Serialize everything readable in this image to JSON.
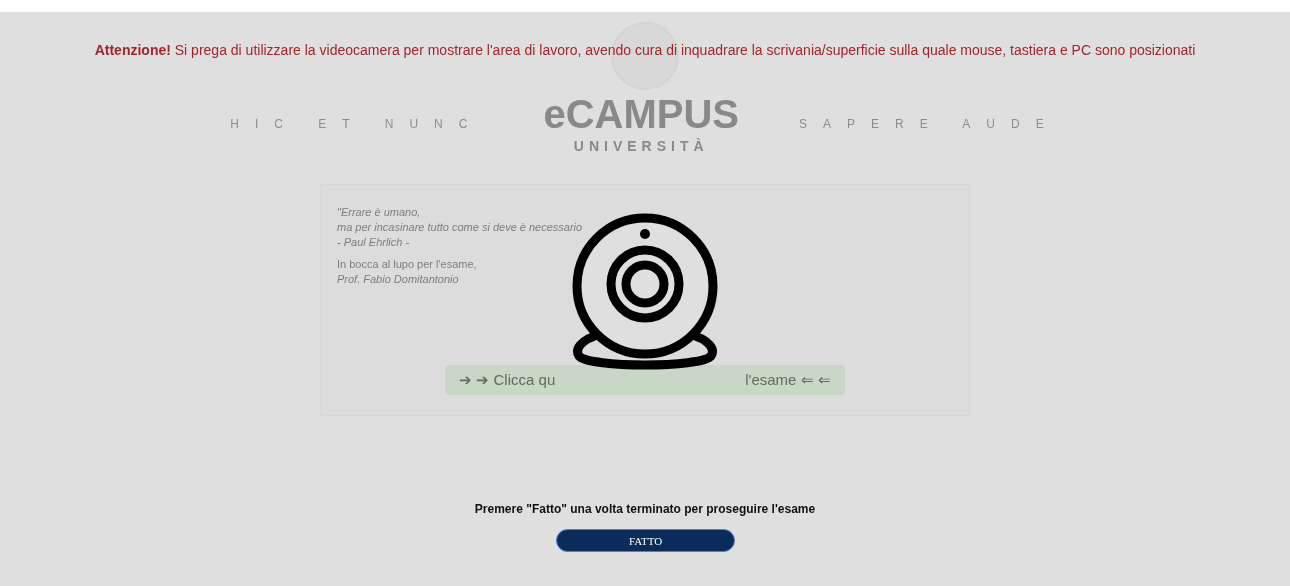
{
  "background_page": {
    "motto_left": "HIC ET NUNC",
    "logo_text": "eCAMPUS",
    "logo_subtext": "UNIVERSITÀ",
    "motto_right": "SAPERE AUDE",
    "quote_lines": [
      "\"Errare è umano,",
      "ma per incasinare tutto come si deve è necessario",
      "- Paul Ehrlich -"
    ],
    "wish_lines": [
      "In bocca al lupo per l'esame,",
      "Prof. Fabio Domitantonio"
    ],
    "start_button": {
      "label_start": "➔ ➔ Clicca qu",
      "label_end": "l'esame ⇐ ⇐"
    }
  },
  "overlay": {
    "warning": "**Attenzione!** Si prega di utilizzare la videocamera per mostrare l'area di lavoro, avendo cura di inquadrare la scrivania/superficie sulla quale mouse, tastiera e PC sono posizionati",
    "instruction": "Premere \"Fatto\" una volta terminato per proseguire l'esame",
    "done_button": "FATTO"
  }
}
